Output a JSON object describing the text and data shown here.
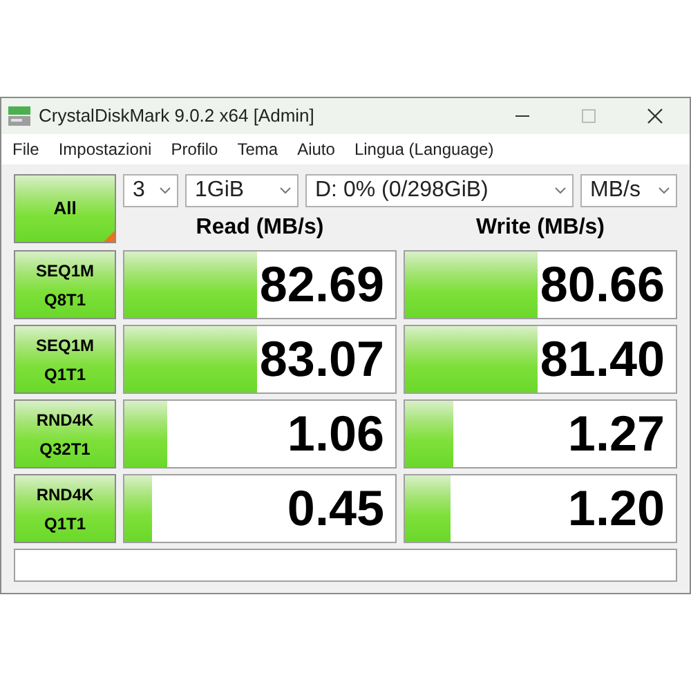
{
  "window": {
    "title": "CrystalDiskMark 9.0.2 x64 [Admin]"
  },
  "menu": [
    "File",
    "Impostazioni",
    "Profilo",
    "Tema",
    "Aiuto",
    "Lingua (Language)"
  ],
  "all_button": "All",
  "selectors": [
    {
      "value": "3",
      "kind": "small"
    },
    {
      "value": "1GiB",
      "kind": "medium"
    },
    {
      "value": "D: 0% (0/298GiB)",
      "kind": "wide"
    },
    {
      "value": "MB/s",
      "kind": "small"
    }
  ],
  "columns": [
    "Read (MB/s)",
    "Write (MB/s)"
  ],
  "tests": [
    {
      "label": [
        "SEQ1M",
        "Q8T1"
      ],
      "read": {
        "value": "82.69",
        "level": 0.49
      },
      "write": {
        "value": "80.66",
        "level": 0.49
      }
    },
    {
      "label": [
        "SEQ1M",
        "Q1T1"
      ],
      "read": {
        "value": "83.07",
        "level": 0.49
      },
      "write": {
        "value": "81.40",
        "level": 0.49
      }
    },
    {
      "label": [
        "RND4K",
        "Q32T1"
      ],
      "read": {
        "value": "1.06",
        "level": 0.16
      },
      "write": {
        "value": "1.27",
        "level": 0.18
      }
    },
    {
      "label": [
        "RND4K",
        "Q1T1"
      ],
      "read": {
        "value": "0.45",
        "level": 0.1
      },
      "write": {
        "value": "1.20",
        "level": 0.17
      }
    }
  ]
}
